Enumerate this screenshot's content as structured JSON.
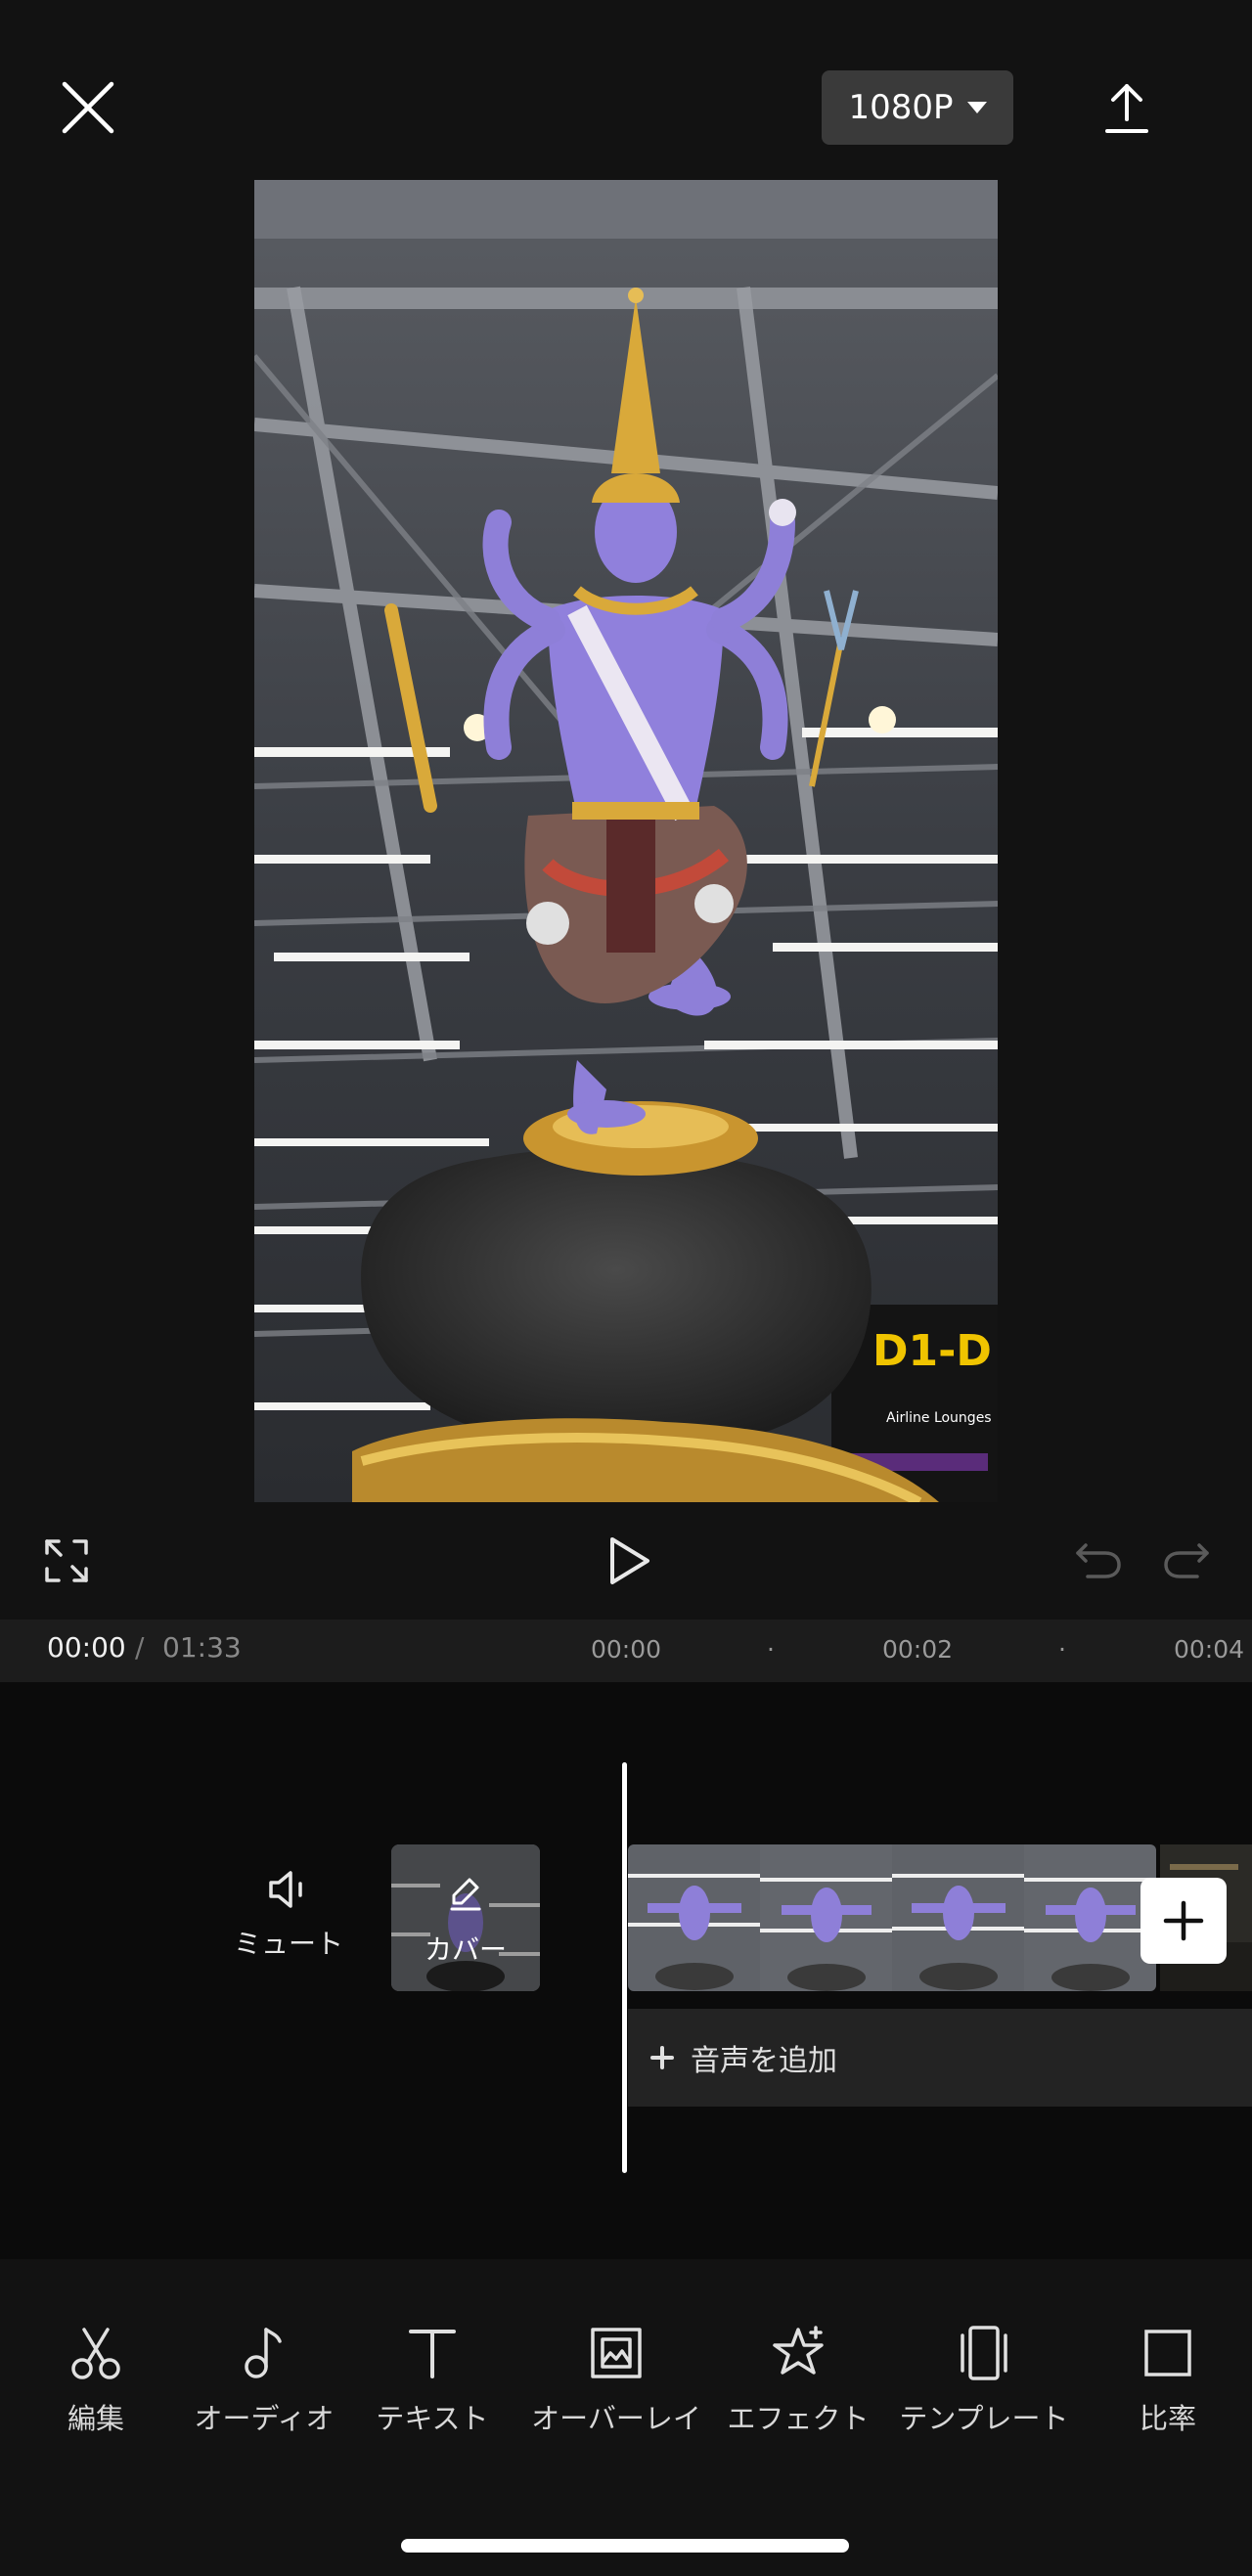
{
  "header": {
    "resolution_label": "1080P"
  },
  "timeline": {
    "current_time": "00:00",
    "separator": "/",
    "total_time": "01:33",
    "ticks": [
      "00:00",
      "00:02",
      "00:04"
    ]
  },
  "tracks": {
    "mute_label": "ミュート",
    "cover_label": "カバー",
    "add_audio_label": "音声を追加"
  },
  "toolbar": {
    "items": [
      {
        "label": "編集",
        "icon": "scissors-icon"
      },
      {
        "label": "オーディオ",
        "icon": "music-note-icon"
      },
      {
        "label": "テキスト",
        "icon": "text-icon"
      },
      {
        "label": "オーバーレイ",
        "icon": "overlay-icon"
      },
      {
        "label": "エフェクト",
        "icon": "effect-star-icon"
      },
      {
        "label": "テンプレート",
        "icon": "template-icon"
      },
      {
        "label": "比率",
        "icon": "ratio-icon"
      }
    ]
  },
  "preview": {
    "sign_text": "D1-D",
    "sign_sub": "Airline Lounges"
  },
  "colors": {
    "background": "#121212",
    "track_background": "#0b0b0b",
    "statue_skin": "#8e7fd8",
    "gold": "#d9a93a"
  }
}
